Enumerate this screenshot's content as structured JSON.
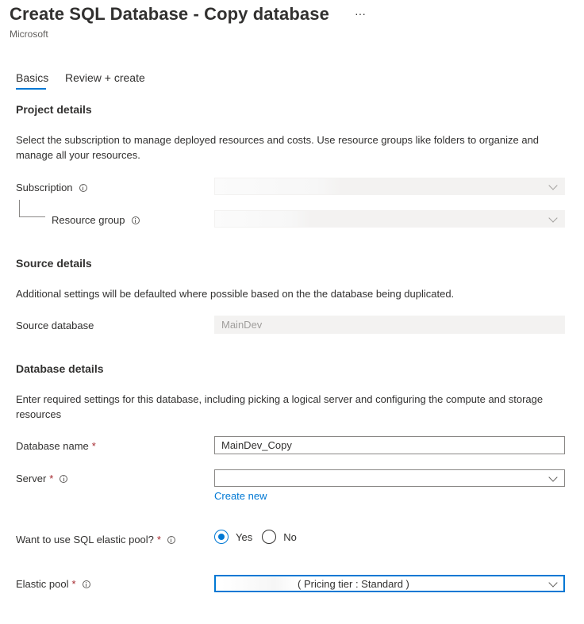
{
  "header": {
    "title": "Create SQL Database - Copy database",
    "more_label": "···",
    "publisher": "Microsoft"
  },
  "tabs": [
    {
      "label": "Basics",
      "active": true
    },
    {
      "label": "Review + create",
      "active": false
    }
  ],
  "project_details": {
    "heading": "Project details",
    "description": "Select the subscription to manage deployed resources and costs. Use resource groups like folders to organize and manage all your resources.",
    "subscription_label": "Subscription",
    "resource_group_label": "Resource group"
  },
  "source_details": {
    "heading": "Source details",
    "description": "Additional settings will be defaulted where possible based on the the database being duplicated.",
    "source_database_label": "Source database",
    "source_database_value": "MainDev"
  },
  "database_details": {
    "heading": "Database details",
    "description": "Enter required settings for this database, including picking a logical server and configuring the compute and storage resources",
    "database_name_label": "Database name",
    "database_name_value": "MainDev_Copy",
    "server_label": "Server",
    "create_new_link": "Create new",
    "elastic_pool_question": "Want to use SQL elastic pool?",
    "elastic_pool_options": {
      "yes": "Yes",
      "no": "No"
    },
    "elastic_pool_selected": "Yes",
    "elastic_pool_label": "Elastic pool",
    "elastic_pool_value": "( Pricing tier : Standard )",
    "required_mark": "*"
  },
  "colors": {
    "accent": "#0078d4",
    "required": "#a4262c",
    "disabled_fill": "#f3f2f1"
  }
}
